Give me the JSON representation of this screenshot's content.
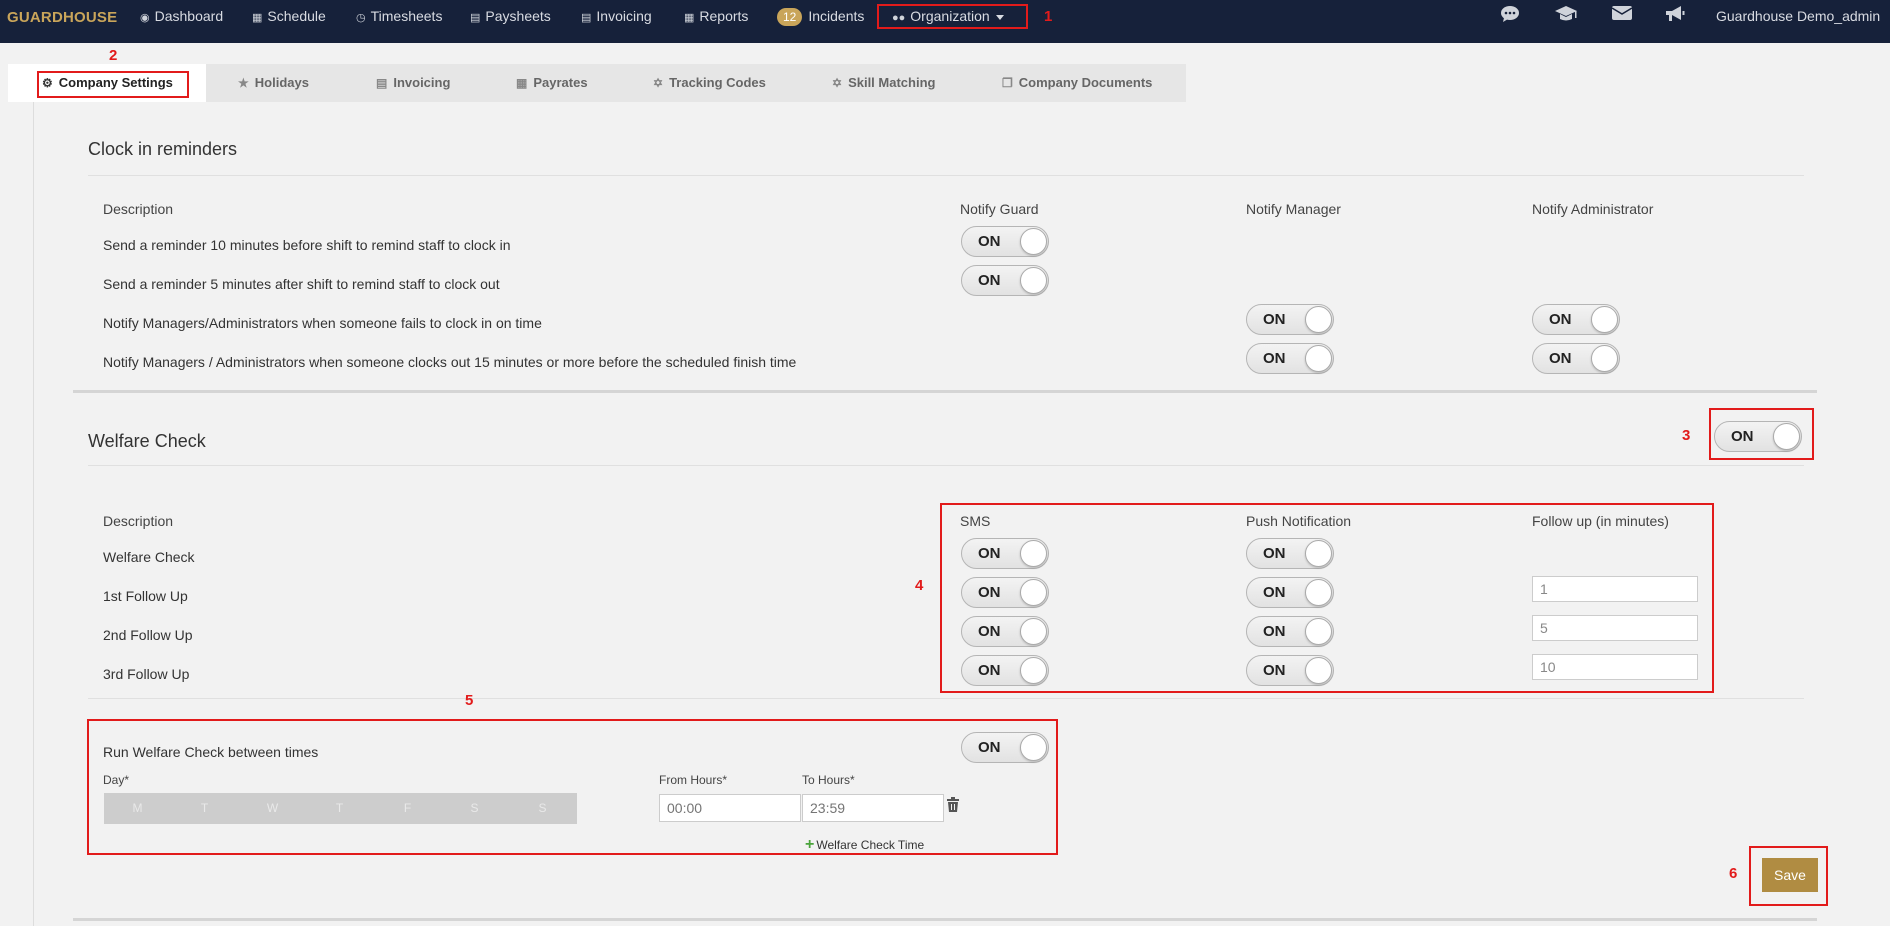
{
  "nav": {
    "brand": "GUARDHOUSE",
    "items": [
      {
        "label": "Dashboard",
        "icon": "dashboard-icon"
      },
      {
        "label": "Schedule",
        "icon": "calendar-icon"
      },
      {
        "label": "Timesheets",
        "icon": "clock-icon"
      },
      {
        "label": "Paysheets",
        "icon": "money-icon"
      },
      {
        "label": "Invoicing",
        "icon": "invoice-icon"
      },
      {
        "label": "Reports",
        "icon": "table-icon"
      },
      {
        "label": "Incidents",
        "badge": "12"
      },
      {
        "label": "Organization",
        "icon": "users-icon"
      }
    ],
    "right_icons": [
      "chat-icon",
      "graduation-cap-icon",
      "envelope-icon",
      "megaphone-icon"
    ],
    "user": "Guardhouse Demo_admin"
  },
  "annotations": [
    "1",
    "2",
    "3",
    "4",
    "5",
    "6"
  ],
  "tabs": [
    {
      "label": "Company Settings",
      "icon": "gear-icon",
      "active": true
    },
    {
      "label": "Holidays",
      "icon": "star-icon"
    },
    {
      "label": "Invoicing",
      "icon": "invoice-icon"
    },
    {
      "label": "Payrates",
      "icon": "calendar-icon"
    },
    {
      "label": "Tracking Codes",
      "icon": "crosshair-icon"
    },
    {
      "label": "Skill Matching",
      "icon": "crosshair-icon"
    },
    {
      "label": "Company Documents",
      "icon": "documents-icon"
    }
  ],
  "clock_in": {
    "title": "Clock in reminders",
    "headers": [
      "Description",
      "Notify Guard",
      "Notify Manager",
      "Notify Administrator"
    ],
    "rows": [
      "Send a reminder 10 minutes before shift to remind staff to clock in",
      "Send a reminder 5 minutes after shift to remind staff to clock out",
      "Notify Managers/Administrators when someone fails to clock in on time",
      "Notify Managers / Administrators when someone clocks out 15 minutes or more before the scheduled finish time"
    ]
  },
  "welfare": {
    "title": "Welfare Check",
    "headers": [
      "Description",
      "SMS",
      "Push Notification",
      "Follow up (in minutes)"
    ],
    "rows": [
      "Welfare Check",
      "1st Follow Up",
      "2nd Follow Up",
      "3rd Follow Up"
    ],
    "followups": [
      "1",
      "5",
      "10"
    ],
    "run_between_label": "Run Welfare Check between times",
    "day_label": "Day*",
    "days": [
      "M",
      "T",
      "W",
      "T",
      "F",
      "S",
      "S"
    ],
    "from_label": "From Hours*",
    "to_label": "To Hours*",
    "from_placeholder": "00:00",
    "to_placeholder": "23:59",
    "add_time": "Welfare Check Time"
  },
  "toggle_on": "ON",
  "save": "Save",
  "colors": {
    "nav_bg": "#16213a",
    "brand": "#c9a55a",
    "accent": "#b08c42",
    "annotation": "#e21b1b"
  }
}
